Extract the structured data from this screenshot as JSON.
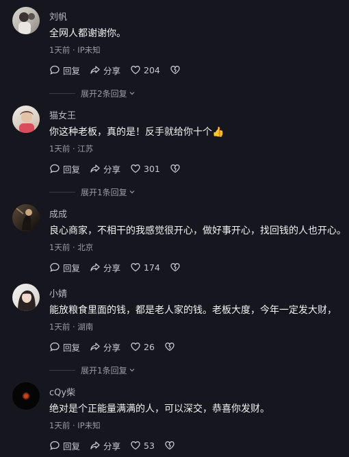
{
  "comments": [
    {
      "name": "刘帆",
      "content": "全网人都谢谢你。",
      "time": "1天前",
      "location": "IP未知",
      "reply_label": "回复",
      "share_label": "分享",
      "likes": "204",
      "expand_label": "展开2条回复"
    },
    {
      "name": "猫女王",
      "content": "你这种老板，真的是！反手就给你十个👍",
      "time": "1天前",
      "location": "江苏",
      "reply_label": "回复",
      "share_label": "分享",
      "likes": "301",
      "expand_label": "展开1条回复"
    },
    {
      "name": "成成",
      "content": "良心商家，不相干的我感觉很开心，做好事开心，找回钱的人也开心。",
      "time": "1天前",
      "location": "北京",
      "reply_label": "回复",
      "share_label": "分享",
      "likes": "174",
      "expand_label": ""
    },
    {
      "name": "小婧",
      "content": "能放粮食里面的钱，都是老人家的钱。老板大度，今年一定发大财，",
      "time": "1天前",
      "location": "湖南",
      "reply_label": "回复",
      "share_label": "分享",
      "likes": "26",
      "expand_label": "展开1条回复"
    },
    {
      "name": "cQy柴",
      "content": "绝对是个正能量满满的人，可以深交，恭喜你发财。",
      "time": "1天前",
      "location": "IP未知",
      "reply_label": "回复",
      "share_label": "分享",
      "likes": "53",
      "expand_label": ""
    }
  ],
  "separator": "·"
}
